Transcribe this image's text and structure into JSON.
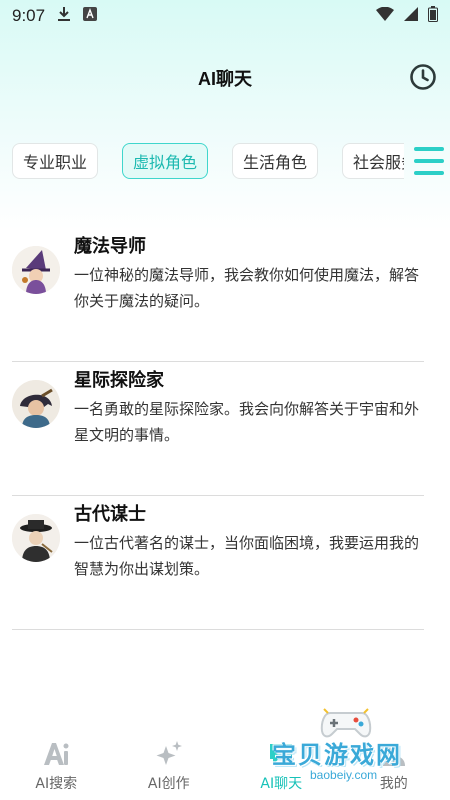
{
  "status_bar": {
    "time": "9:07"
  },
  "header": {
    "title": "AI聊天"
  },
  "tabs": [
    {
      "label": "专业职业",
      "active": false
    },
    {
      "label": "虚拟角色",
      "active": true
    },
    {
      "label": "生活角色",
      "active": false
    },
    {
      "label": "社会服务",
      "active": false
    }
  ],
  "characters": [
    {
      "name": "魔法导师",
      "description": "一位神秘的魔法导师，我会教你如何使用魔法，解答你关于魔法的疑问。"
    },
    {
      "name": "星际探险家",
      "description": "一名勇敢的星际探险家。我会向你解答关于宇宙和外星文明的事情。"
    },
    {
      "name": "古代谋士",
      "description": "一位古代著名的谋士，当你面临困境，我要运用我的智慧为你出谋划策。"
    }
  ],
  "bottom_nav": [
    {
      "label": "AI搜索",
      "icon": "ai-text-icon",
      "active": false
    },
    {
      "label": "AI创作",
      "icon": "sparkle-icon",
      "active": false
    },
    {
      "label": "AI聊天",
      "icon": "chat-icon",
      "active": true
    },
    {
      "label": "我的",
      "icon": "user-icon",
      "active": false
    }
  ],
  "watermark": {
    "text": "宝贝游戏网",
    "url": "baobeiy.com"
  },
  "colors": {
    "accent": "#2ccfc7",
    "accent_text": "#17c2b8",
    "active_tab_bg": "#e3faf7"
  }
}
